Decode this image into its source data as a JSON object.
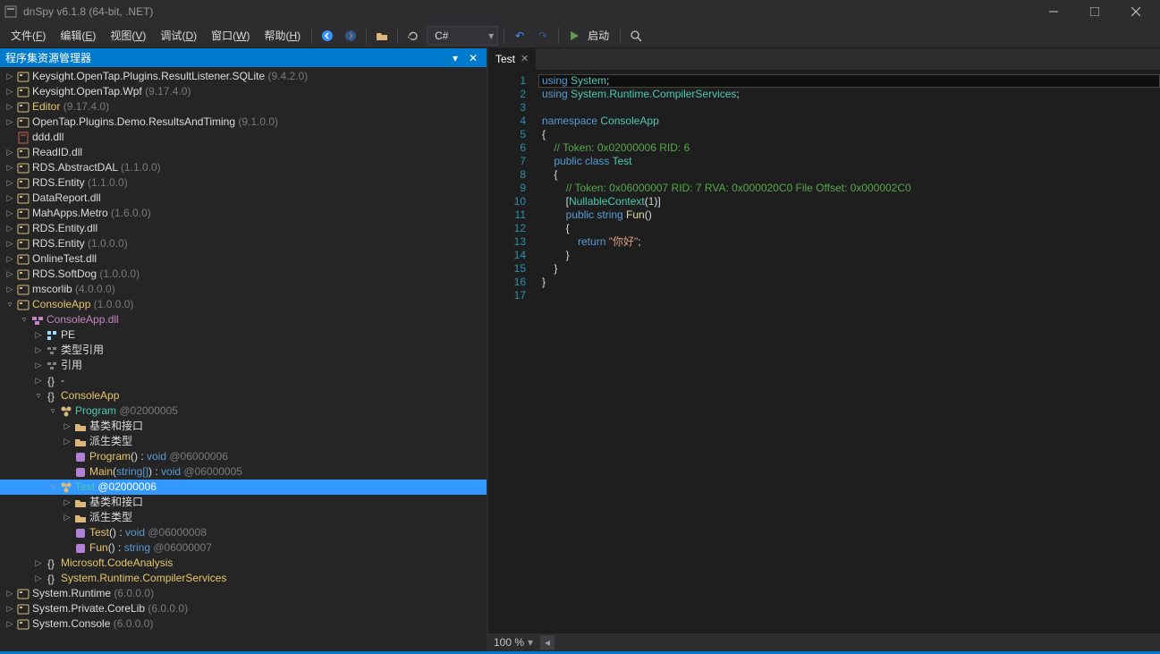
{
  "app": {
    "title": "dnSpy v6.1.8 (64-bit, .NET)"
  },
  "menu": {
    "file": {
      "label": "文件",
      "hk": "F"
    },
    "edit": {
      "label": "编辑",
      "hk": "E"
    },
    "view": {
      "label": "视图",
      "hk": "V"
    },
    "debug": {
      "label": "调试",
      "hk": "D"
    },
    "window": {
      "label": "窗口",
      "hk": "W"
    },
    "help": {
      "label": "帮助",
      "hk": "H"
    },
    "run": {
      "label": "启动"
    },
    "lang_combo": "C#"
  },
  "panel": {
    "title": "程序集资源管理器"
  },
  "tree": [
    {
      "d": 0,
      "tw": "▷",
      "ic": "asm",
      "txt": "Keysight.OpenTap.Plugins.ResultListener.SQLite",
      "ver": "(9.4.2.0)"
    },
    {
      "d": 0,
      "tw": "▷",
      "ic": "asm",
      "txt": "Keysight.OpenTap.Wpf",
      "ver": "(9.17.4.0)"
    },
    {
      "d": 0,
      "tw": "▷",
      "ic": "asm",
      "txt": "Editor",
      "ver": "(9.17.4.0)",
      "gold": true
    },
    {
      "d": 0,
      "tw": "▷",
      "ic": "asm",
      "txt": "OpenTap.Plugins.Demo.ResultsAndTiming",
      "ver": "(9.1.0.0)"
    },
    {
      "d": 0,
      "tw": "",
      "ic": "dll",
      "txt": "ddd.dll"
    },
    {
      "d": 0,
      "tw": "▷",
      "ic": "asm",
      "txt": "ReadID.dll"
    },
    {
      "d": 0,
      "tw": "▷",
      "ic": "asm",
      "txt": "RDS.AbstractDAL",
      "ver": "(1.1.0.0)"
    },
    {
      "d": 0,
      "tw": "▷",
      "ic": "asm",
      "txt": "RDS.Entity",
      "ver": "(1.1.0.0)"
    },
    {
      "d": 0,
      "tw": "▷",
      "ic": "asm",
      "txt": "DataReport.dll"
    },
    {
      "d": 0,
      "tw": "▷",
      "ic": "asm",
      "txt": "MahApps.Metro",
      "ver": "(1.6.0.0)"
    },
    {
      "d": 0,
      "tw": "▷",
      "ic": "asm",
      "txt": "RDS.Entity.dll"
    },
    {
      "d": 0,
      "tw": "▷",
      "ic": "asm",
      "txt": "RDS.Entity",
      "ver": "(1.0.0.0)"
    },
    {
      "d": 0,
      "tw": "▷",
      "ic": "asm",
      "txt": "OnlineTest.dll"
    },
    {
      "d": 0,
      "tw": "▷",
      "ic": "asm",
      "txt": "RDS.SoftDog",
      "ver": "(1.0.0.0)"
    },
    {
      "d": 0,
      "tw": "▷",
      "ic": "asm",
      "txt": "mscorlib",
      "ver": "(4.0.0.0)"
    },
    {
      "d": 0,
      "tw": "▿",
      "ic": "asm",
      "txt": "ConsoleApp",
      "ver": "(1.0.0.0)",
      "gold": true
    },
    {
      "d": 1,
      "tw": "▿",
      "ic": "mod",
      "txt": "ConsoleApp.dll",
      "purple": true
    },
    {
      "d": 2,
      "tw": "▷",
      "ic": "pe",
      "txt": "PE"
    },
    {
      "d": 2,
      "tw": "▷",
      "ic": "ref",
      "txt": "类型引用"
    },
    {
      "d": 2,
      "tw": "▷",
      "ic": "ref",
      "txt": "引用"
    },
    {
      "d": 2,
      "tw": "▷",
      "ic": "ns",
      "txt": "-"
    },
    {
      "d": 2,
      "tw": "▿",
      "ic": "ns",
      "txt": "ConsoleApp",
      "gold": true
    },
    {
      "d": 3,
      "tw": "▿",
      "ic": "cls",
      "txt": "Program",
      "tok": " @02000005",
      "teal": true
    },
    {
      "d": 4,
      "tw": "▷",
      "ic": "fld",
      "txt": "基类和接口"
    },
    {
      "d": 4,
      "tw": "▷",
      "ic": "fld",
      "txt": "派生类型"
    },
    {
      "d": 4,
      "tw": "",
      "ic": "mth",
      "txt": "Program",
      "sig": "() : ",
      "ret": "void",
      "tok": " @06000006",
      "gold": true
    },
    {
      "d": 4,
      "tw": "",
      "ic": "mth",
      "txt": "Main",
      "sig": "(",
      "arg": "string[]",
      "sig2": ") : ",
      "ret": "void",
      "tok": " @06000005",
      "gold": true
    },
    {
      "d": 3,
      "tw": "▿",
      "ic": "cls",
      "txt": "Test",
      "tok": " @02000006",
      "teal": true,
      "sel": true
    },
    {
      "d": 4,
      "tw": "▷",
      "ic": "fld",
      "txt": "基类和接口"
    },
    {
      "d": 4,
      "tw": "▷",
      "ic": "fld",
      "txt": "派生类型"
    },
    {
      "d": 4,
      "tw": "",
      "ic": "mth",
      "txt": "Test",
      "sig": "() : ",
      "ret": "void",
      "tok": " @06000008",
      "gold": true
    },
    {
      "d": 4,
      "tw": "",
      "ic": "mth",
      "txt": "Fun",
      "sig": "() : ",
      "ret": "string",
      "tok": " @06000007",
      "gold": true
    },
    {
      "d": 2,
      "tw": "▷",
      "ic": "ns",
      "txt": "Microsoft.CodeAnalysis",
      "gold": true
    },
    {
      "d": 2,
      "tw": "▷",
      "ic": "ns",
      "txt": "System.Runtime.CompilerServices",
      "gold": true
    },
    {
      "d": 0,
      "tw": "▷",
      "ic": "asm",
      "txt": "System.Runtime",
      "ver": "(6.0.0.0)"
    },
    {
      "d": 0,
      "tw": "▷",
      "ic": "asm",
      "txt": "System.Private.CoreLib",
      "ver": "(6.0.0.0)"
    },
    {
      "d": 0,
      "tw": "▷",
      "ic": "asm",
      "txt": "System.Console",
      "ver": "(6.0.0.0)"
    }
  ],
  "editor": {
    "tab": "Test",
    "zoom": "100 %",
    "lines": [
      [
        {
          "t": "using ",
          "c": "kw"
        },
        {
          "t": "System",
          "c": "tp"
        },
        {
          "t": ";",
          "c": "op"
        }
      ],
      [
        {
          "t": "using ",
          "c": "kw"
        },
        {
          "t": "System.Runtime.CompilerServices",
          "c": "tp"
        },
        {
          "t": ";",
          "c": "op"
        }
      ],
      [],
      [
        {
          "t": "namespace ",
          "c": "kw"
        },
        {
          "t": "ConsoleApp",
          "c": "tp"
        }
      ],
      [
        {
          "t": "{",
          "c": "op"
        }
      ],
      [
        {
          "t": "    ",
          "c": ""
        },
        {
          "t": "// Token: 0x02000006 RID: 6",
          "c": "cm"
        }
      ],
      [
        {
          "t": "    ",
          "c": ""
        },
        {
          "t": "public class ",
          "c": "kw"
        },
        {
          "t": "Test",
          "c": "tp"
        }
      ],
      [
        {
          "t": "    {",
          "c": "op"
        }
      ],
      [
        {
          "t": "        ",
          "c": ""
        },
        {
          "t": "// Token: 0x06000007 RID: 7 RVA: 0x000020C0 File Offset: 0x000002C0",
          "c": "cm"
        }
      ],
      [
        {
          "t": "        [",
          "c": "op"
        },
        {
          "t": "NullableContext",
          "c": "tp"
        },
        {
          "t": "(",
          "c": "op"
        },
        {
          "t": "1",
          "c": "num"
        },
        {
          "t": ")]",
          "c": "op"
        }
      ],
      [
        {
          "t": "        ",
          "c": ""
        },
        {
          "t": "public ",
          "c": "kw"
        },
        {
          "t": "string ",
          "c": "kw"
        },
        {
          "t": "Fun",
          "c": "fn"
        },
        {
          "t": "()",
          "c": "op"
        }
      ],
      [
        {
          "t": "        {",
          "c": "op"
        }
      ],
      [
        {
          "t": "            ",
          "c": ""
        },
        {
          "t": "return ",
          "c": "kw"
        },
        {
          "t": "\"你好\"",
          "c": "str"
        },
        {
          "t": ";",
          "c": "op"
        }
      ],
      [
        {
          "t": "        }",
          "c": "op"
        }
      ],
      [
        {
          "t": "    }",
          "c": "op"
        }
      ],
      [
        {
          "t": "}",
          "c": "op"
        }
      ],
      []
    ]
  }
}
